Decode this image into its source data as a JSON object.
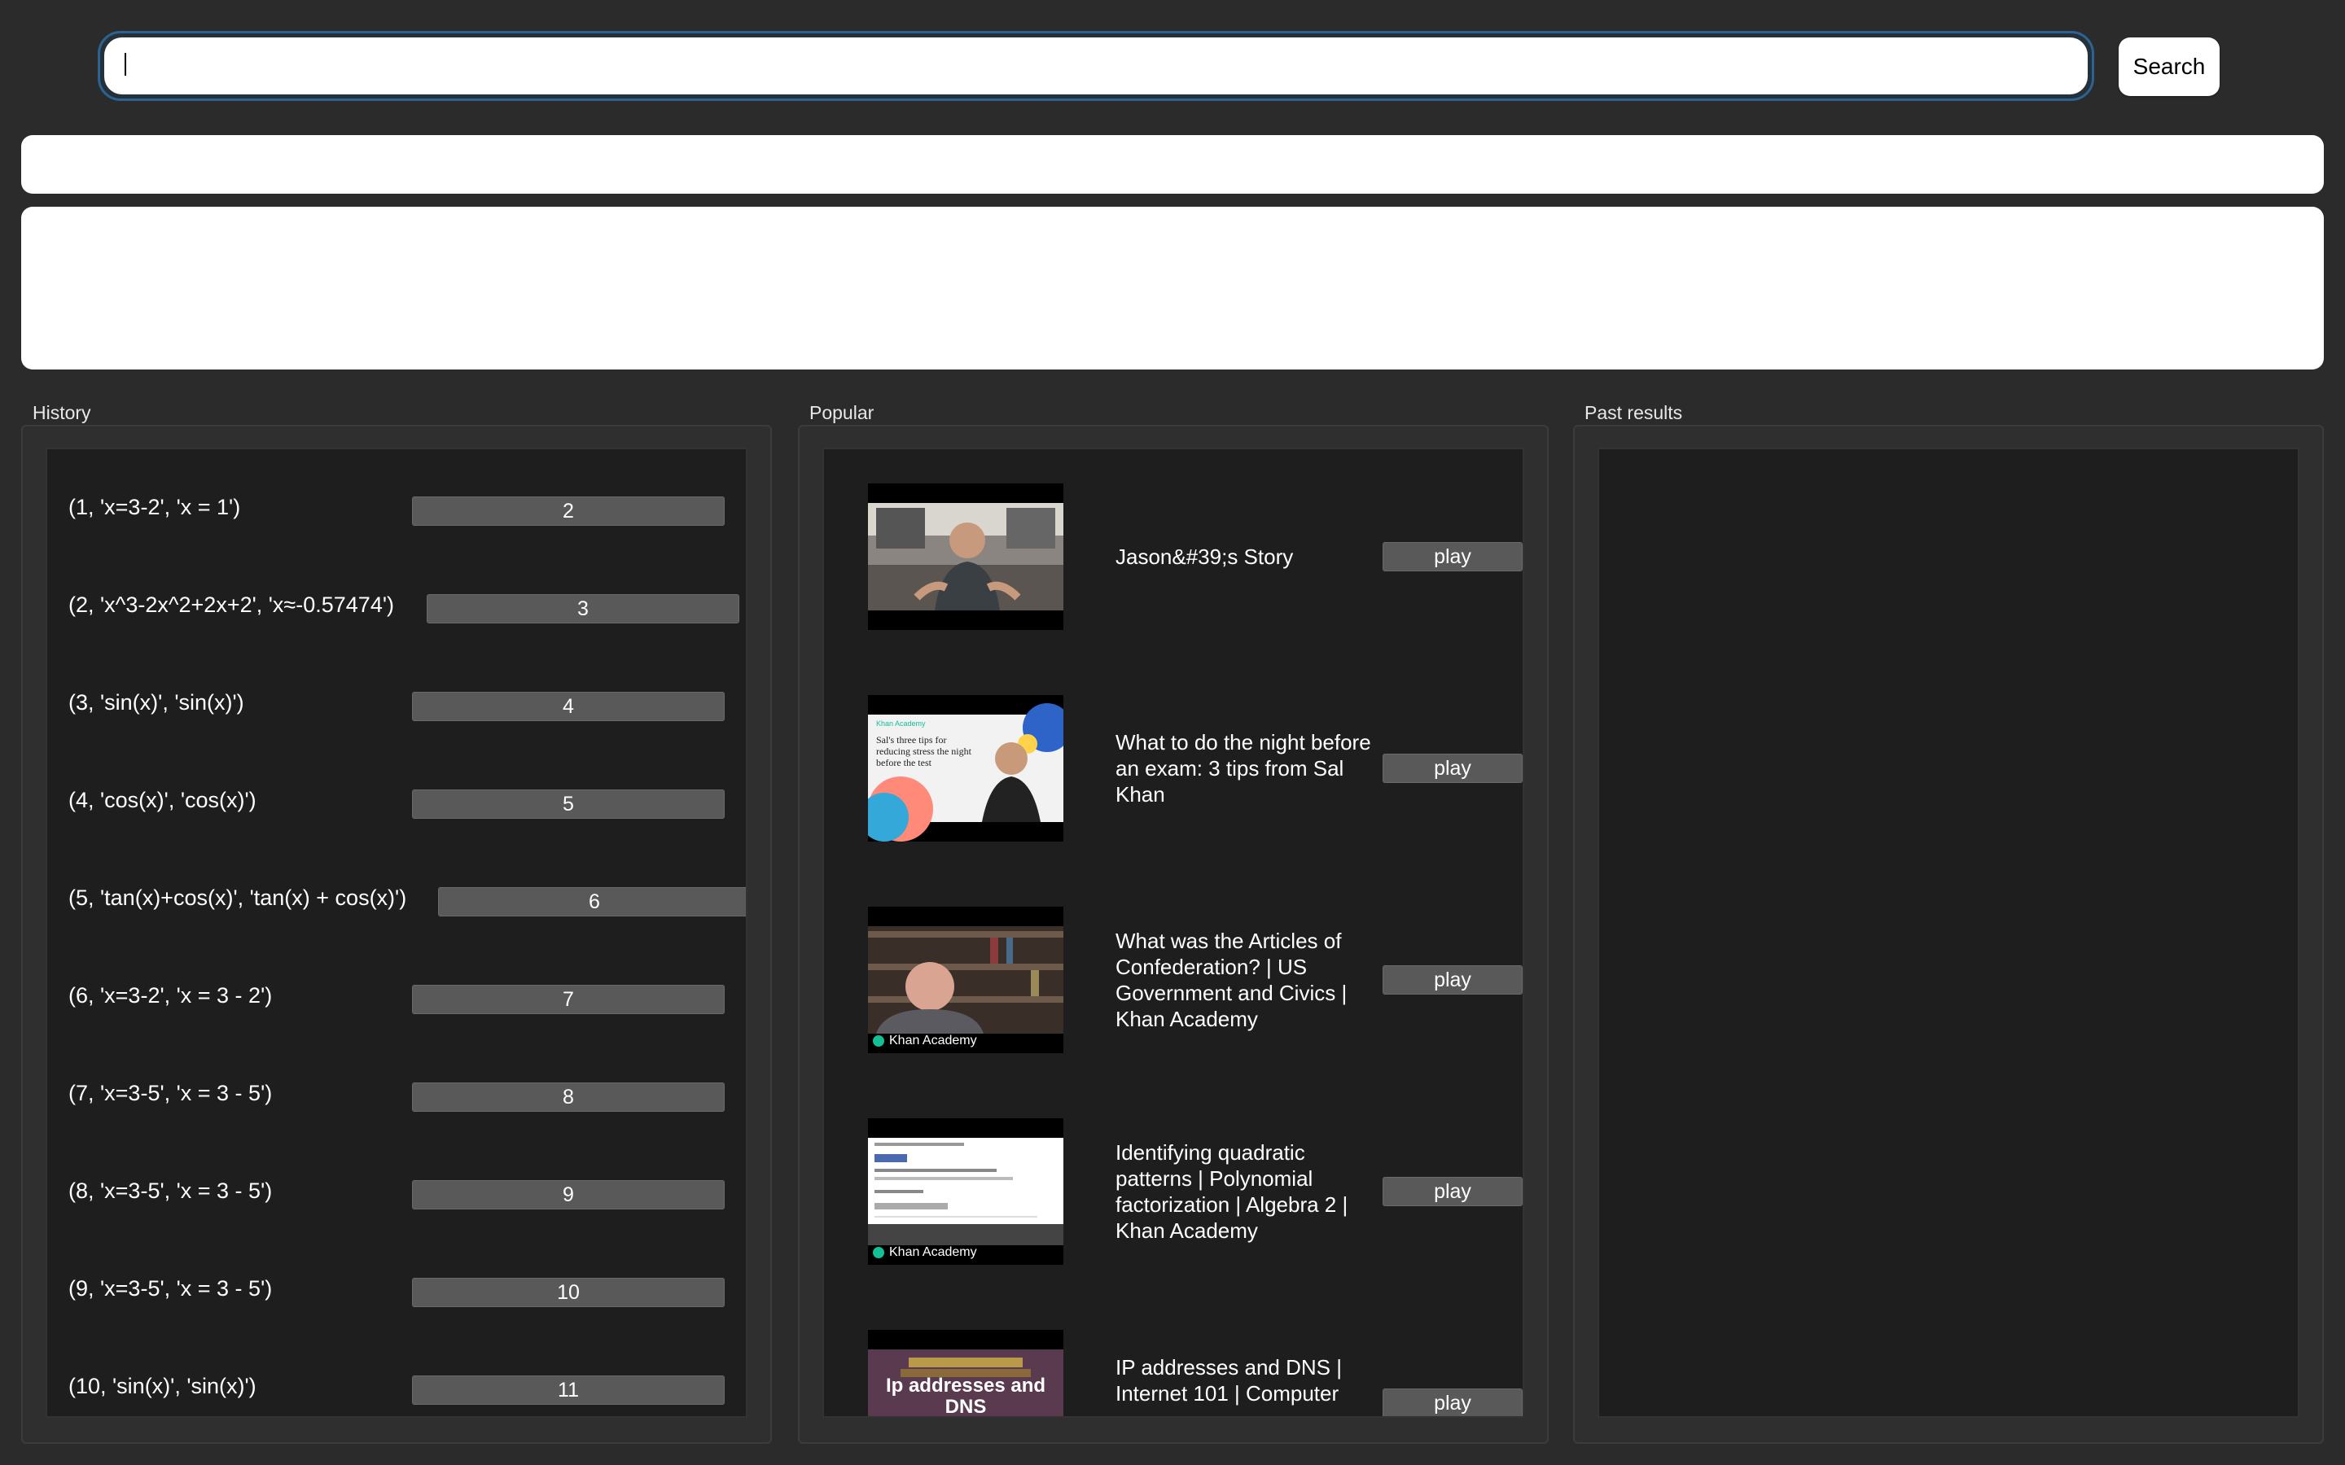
{
  "search": {
    "value": "",
    "button_label": "Search"
  },
  "columns": {
    "history_label": "History",
    "popular_label": "Popular",
    "past_results_label": "Past results"
  },
  "history": [
    {
      "text": "(1, 'x=3-2', 'x = 1')",
      "button": "2"
    },
    {
      "text": "(2, 'x^3-2x^2+2x+2', 'x≈-0.57474')",
      "button": "3"
    },
    {
      "text": "(3, 'sin(x)', 'sin(x)')",
      "button": "4"
    },
    {
      "text": "(4, 'cos(x)', 'cos(x)')",
      "button": "5"
    },
    {
      "text": "(5, 'tan(x)+cos(x)', 'tan(x) + cos(x)')",
      "button": "6"
    },
    {
      "text": "(6, 'x=3-2', 'x = 3 - 2')",
      "button": "7"
    },
    {
      "text": "(7, 'x=3-5', 'x = 3 - 5')",
      "button": "8"
    },
    {
      "text": "(8, 'x=3-5', 'x = 3 - 5')",
      "button": "9"
    },
    {
      "text": "(9, 'x=3-5', 'x = 3 - 5')",
      "button": "10"
    },
    {
      "text": "(10, 'sin(x)', 'sin(x)')",
      "button": "11"
    }
  ],
  "popular": [
    {
      "title": "Jason&#39;s  Story",
      "button": "play"
    },
    {
      "title": "What to do the night before an exam: 3 tips from Sal Khan",
      "button": "play",
      "thumb_text": "Sal's three tips for reducing stress the night before the test",
      "thumb_brand": "Khan Academy"
    },
    {
      "title": "What was the Articles of Confederation? | US Government and Civics | Khan Academy",
      "button": "play",
      "thumb_brand": "Khan Academy"
    },
    {
      "title": "Identifying quadratic patterns | Polynomial factorization | Algebra 2 | Khan Academy",
      "button": "play",
      "thumb_brand": "Khan Academy"
    },
    {
      "title": "IP addresses and DNS | Internet 101 | Computer",
      "button": "play",
      "thumb_text": "Ip addresses and DNS"
    }
  ]
}
